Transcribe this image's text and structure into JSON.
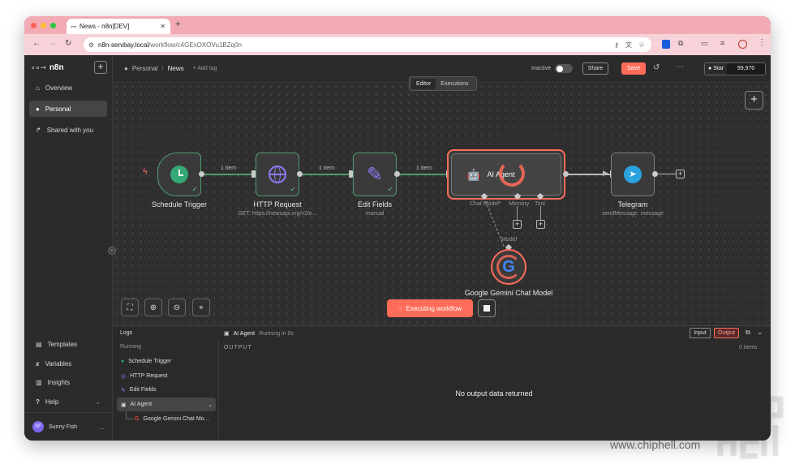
{
  "browser": {
    "tab_title": "News - n8n[DEV]",
    "new_tab": "+",
    "url_host": "n8n-servbay.local",
    "url_path": "/workflow/c4GExOXOVu1BZq0n"
  },
  "sidebar": {
    "logo": "n8n",
    "items": [
      {
        "label": "Overview"
      },
      {
        "label": "Personal"
      },
      {
        "label": "Shared with you"
      }
    ],
    "bottom_items": [
      {
        "label": "Templates"
      },
      {
        "label": "Variables"
      },
      {
        "label": "Insights"
      },
      {
        "label": "Help"
      }
    ],
    "user": {
      "initials": "SF",
      "name": "Sunny Fish",
      "more": "..."
    }
  },
  "topbar": {
    "breadcrumb_root": "Personal",
    "breadcrumb_sep": "/",
    "workflow_name": "News",
    "add_tag": "+ Add tag",
    "status": "Inactive",
    "share": "Share",
    "save": "Save",
    "github_star": "Star",
    "star_count": "99,970"
  },
  "tabs": {
    "editor": "Editor",
    "executions": "Executions"
  },
  "nodes": {
    "schedule": {
      "label": "Schedule Trigger"
    },
    "http": {
      "label": "HTTP Request",
      "sub": "GET: https://newsapi.org/v2/e..."
    },
    "edit": {
      "label": "Edit Fields",
      "sub": "manual"
    },
    "agent": {
      "label": "AI Agent",
      "chat_model": "Chat Model*",
      "memory": "Memory",
      "tool": "Tool"
    },
    "telegram": {
      "label": "Telegram",
      "sub": "sendMessage: message"
    },
    "gemini": {
      "label": "Google Gemini Chat Model",
      "model_label": "Model"
    }
  },
  "connections": {
    "c1": "1 item",
    "c2": "1 item",
    "c3": "1 item"
  },
  "canvas": {
    "executing": "Executing workflow"
  },
  "logs": {
    "title": "Logs",
    "running": "Running",
    "items": [
      {
        "label": "Schedule Trigger"
      },
      {
        "label": "HTTP Request"
      },
      {
        "label": "Edit Fields"
      },
      {
        "label": "AI Agent"
      },
      {
        "label": "Google Gemini Chat Mo..."
      }
    ],
    "selected_node": "AI Agent",
    "selected_status": "Running in 0s",
    "input_btn": "Input",
    "output_btn": "Output",
    "output_header": "OUTPUT",
    "items_count": "0 items",
    "empty_msg": "No output data returned"
  },
  "watermark": {
    "site": "www.chiphell.com",
    "logo_text": "chip hell"
  },
  "colors": {
    "accent": "#ff6d5a",
    "success": "#5fbf84",
    "tab_bar": "#f2aab4"
  }
}
